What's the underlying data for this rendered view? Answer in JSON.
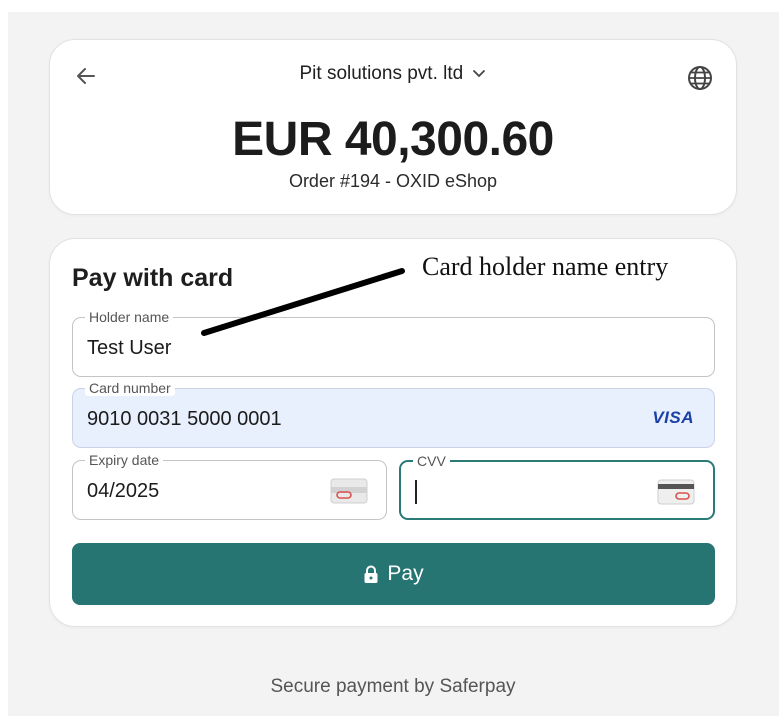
{
  "header": {
    "merchant_name": "Pit solutions pvt. ltd",
    "amount": "EUR 40,300.60",
    "order_label": "Order #194 - OXID eShop"
  },
  "payment": {
    "title": "Pay with card",
    "holder": {
      "label": "Holder name",
      "value": "Test User"
    },
    "card_number": {
      "label": "Card number",
      "value": "9010 0031 5000 0001",
      "brand": "VISA"
    },
    "expiry": {
      "label": "Expiry date",
      "value": "04/2025"
    },
    "cvv": {
      "label": "CVV",
      "value": ""
    },
    "pay_button_label": "Pay"
  },
  "footer": {
    "text": "Secure payment by Saferpay"
  },
  "annotation": {
    "text": "Card holder name entry"
  },
  "colors": {
    "accent": "#277573",
    "card_field_bg": "#e8effd",
    "visa": "#1a3fa6"
  },
  "icons": [
    "arrow-left-icon",
    "globe-icon",
    "chevron-down-icon",
    "lock-icon",
    "card-back-icon"
  ]
}
